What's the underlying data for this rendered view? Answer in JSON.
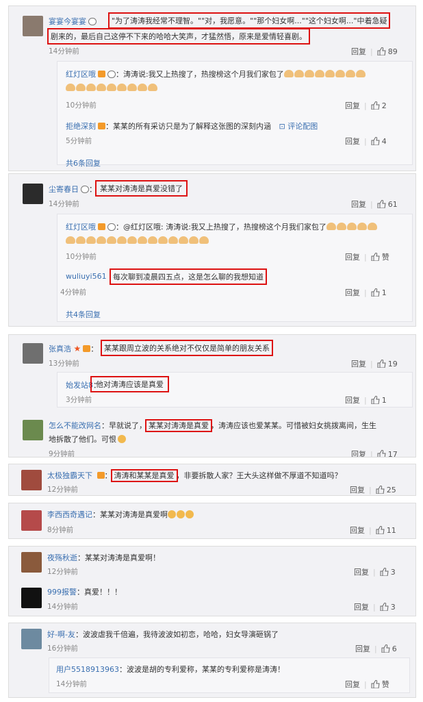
{
  "labels": {
    "reply": "回复",
    "sep": "|",
    "praise": "赞"
  },
  "block1": {
    "c1": {
      "user": "宴宴今宴宴",
      "line1": "\"为了涛涛我经常不理智。\"\"对，我愿意。\"\"那个妇女啊...\"\"这个妇女啊...\"中着急疑",
      "line2": "剧来的，最后自己这停不下来的哈哈大笑声，才猛然悟，原来是爱情轻喜剧。",
      "time": "14分钟前",
      "likes": "89"
    },
    "r1": {
      "user": "红灯区哦",
      "text": "：涛涛说:我又上热搜了，热搜榜这个月我们家包了",
      "time": "10分钟前",
      "likes": "2"
    },
    "r2": {
      "user": "拒绝深刻",
      "text": "：某某的所有采访只是为了解释这张图的深刻内涵",
      "link": "评论配图",
      "time": "5分钟前",
      "likes": "4"
    },
    "more": "共6条回复"
  },
  "block2": {
    "c1": {
      "user": "尘寄春日",
      "text": "某某对涛涛是真爱没错了",
      "time": "14分钟前",
      "likes": "61"
    },
    "r1": {
      "user": "红灯区哦",
      "text": "：@红灯区哦: 涛涛说:我又上热搜了，热搜榜这个月我们家包了",
      "time": "10分钟前",
      "likes": "赞"
    },
    "r2": {
      "user": "wuliuyi561",
      "text": "每次聊到凌晨四五点，这是怎么聊的我想知道",
      "time": "4分钟前",
      "likes": "1"
    },
    "more": "共4条回复"
  },
  "block3": {
    "c1": {
      "user": "张真浩",
      "text": "某某跟周立波的关系绝对不仅仅是简单的朋友关系",
      "time": "13分钟前",
      "likes": "19"
    },
    "r1": {
      "user": "始发站8",
      "text": "他对涛涛应该是真爱",
      "time": "3分钟前",
      "likes": "1"
    },
    "c2": {
      "user": "怎么不能改网名",
      "pre": "：早就说了，",
      "hl": "某某对涛涛是真爱",
      "post": "，涛涛应该也爱某某。可惜被妇女挑拨离间，生生",
      "line2": "地拆散了他们。可恨",
      "time": "9分钟前",
      "likes": "17"
    }
  },
  "block4": {
    "c1": {
      "user": "太极独霸天下",
      "hl": "涛涛和某某是真爱",
      "post": "，非要拆散人家？王大头这样做不厚道不知道吗？",
      "time": "12分钟前",
      "likes": "25"
    }
  },
  "block5": {
    "c1": {
      "user": "李西西奇遇记",
      "text": "：某某对涛涛是真爱啊",
      "time": "8分钟前",
      "likes": "11"
    }
  },
  "block6": {
    "c1": {
      "user": "夜殇秋逝",
      "text": "：某某对涛涛是真爱啊！",
      "time": "12分钟前",
      "likes": "3"
    },
    "c2": {
      "user": "999报警",
      "text": "：真爱！！！",
      "time": "14分钟前",
      "likes": "3"
    }
  },
  "block7": {
    "c1": {
      "user": "好-啊-友",
      "text": "：波波虐我千倍遍，我待波波如初恋，哈哈，妇女导演砸锅了",
      "time": "16分钟前",
      "likes": "6"
    },
    "r1": {
      "user": "用户5518913963",
      "text": "：波波是胡的专利爱称，某某的专利爱称是涛涛！",
      "time": "14分钟前",
      "likes": "赞"
    }
  },
  "colors": {
    "link": "#3a6fb0",
    "highlight": "#d11111",
    "panel": "#f2f2f5"
  }
}
